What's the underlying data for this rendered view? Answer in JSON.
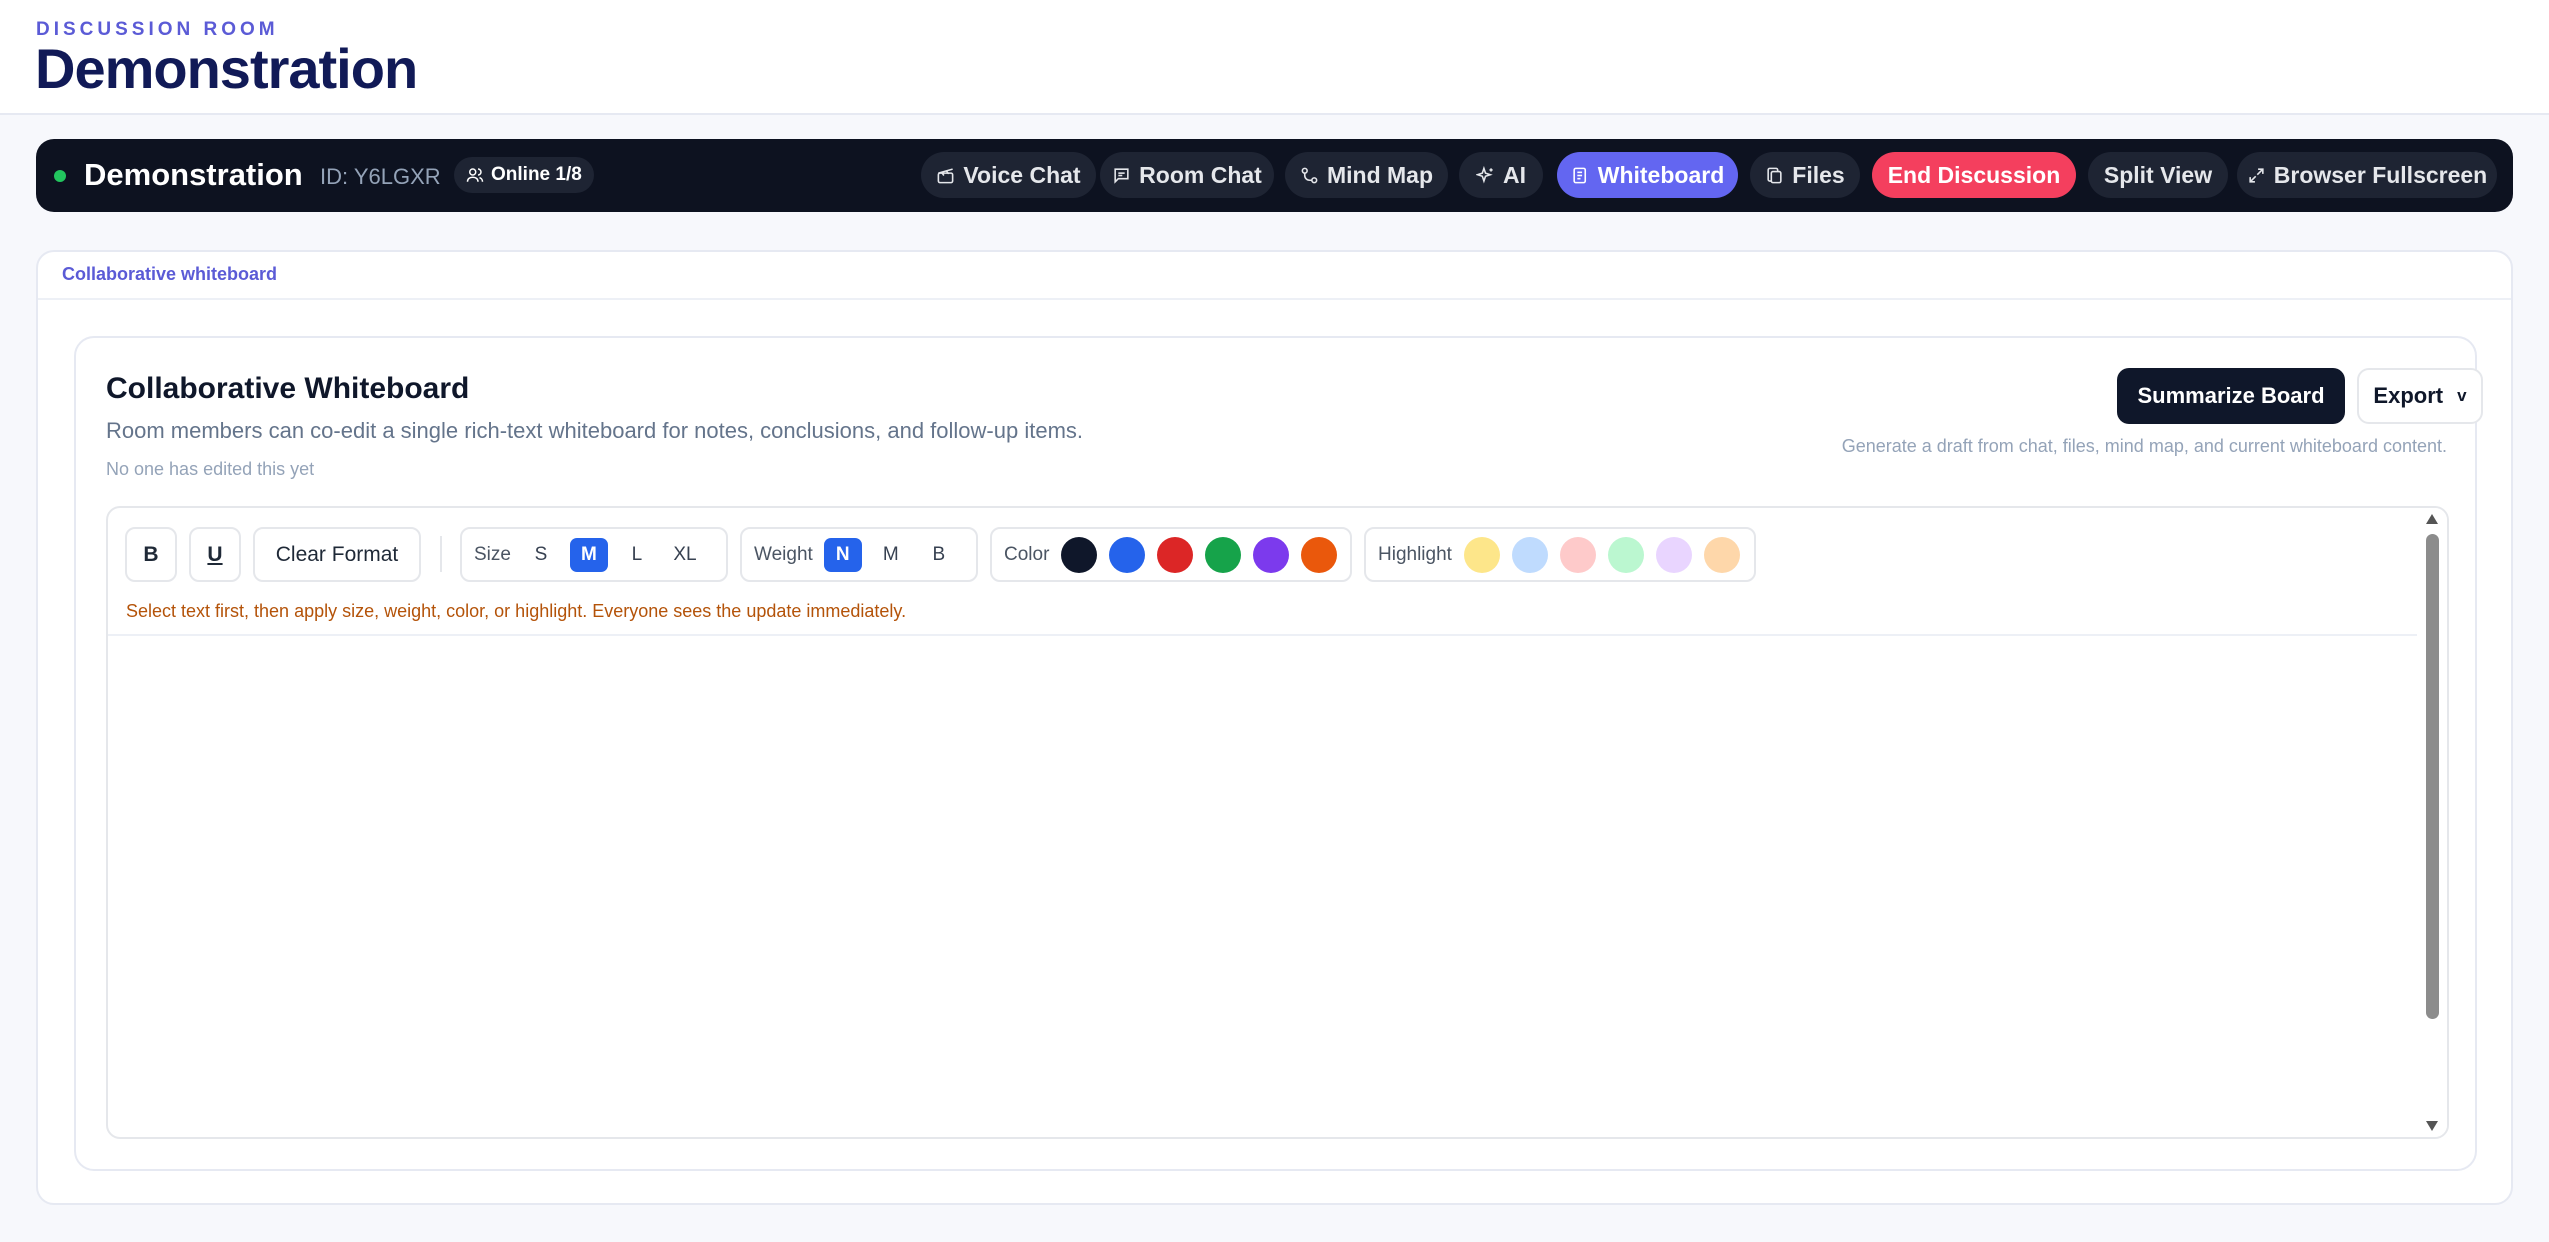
{
  "header": {
    "eyebrow": "DISCUSSION ROOM",
    "title": "Demonstration"
  },
  "room_bar": {
    "name": "Demonstration",
    "id_text": "ID: Y6LGXR",
    "online": "Online 1/8",
    "status_color": "#22c55e",
    "nav": [
      {
        "label": "Voice Chat",
        "icon": "voice-chat-icon"
      },
      {
        "label": "Room Chat",
        "icon": "chat-bubble-icon"
      },
      {
        "label": "Mind Map",
        "icon": "mind-map-icon"
      },
      {
        "label": "AI",
        "icon": "sparkle-icon"
      },
      {
        "label": "Whiteboard",
        "icon": "whiteboard-icon",
        "active": true
      },
      {
        "label": "Files",
        "icon": "files-icon"
      }
    ],
    "end_label": "End Discussion",
    "split_label": "Split View",
    "fullscreen_label": "Browser Fullscreen"
  },
  "panel": {
    "tab_label": "Collaborative whiteboard"
  },
  "whiteboard": {
    "title": "Collaborative Whiteboard",
    "description": "Room members can co-edit a single rich-text whiteboard for notes, conclusions, and follow-up items.",
    "last_edited": "No one has edited this yet",
    "summarize_label": "Summarize Board",
    "export_label": "Export",
    "export_chevron": "v",
    "summary_hint": "Generate a draft from chat, files, mind map, and current whiteboard content."
  },
  "toolbar": {
    "bold": "B",
    "underline": "U",
    "clear_format": "Clear Format",
    "size_label": "Size",
    "sizes": [
      "S",
      "M",
      "L",
      "XL"
    ],
    "size_selected": "M",
    "weight_label": "Weight",
    "weights": [
      "N",
      "M",
      "B"
    ],
    "weight_selected": "N",
    "color_label": "Color",
    "colors": [
      "#0f172a",
      "#2563eb",
      "#dc2626",
      "#16a34a",
      "#7c3aed",
      "#ea580c"
    ],
    "highlight_label": "Highlight",
    "highlights": [
      "#fde68a",
      "#bfdbfe",
      "#fecaca",
      "#bbf7d0",
      "#e9d5ff",
      "#fed7aa"
    ],
    "hint": "Select text first, then apply size, weight, color, or highlight. Everyone sees the update immediately."
  }
}
